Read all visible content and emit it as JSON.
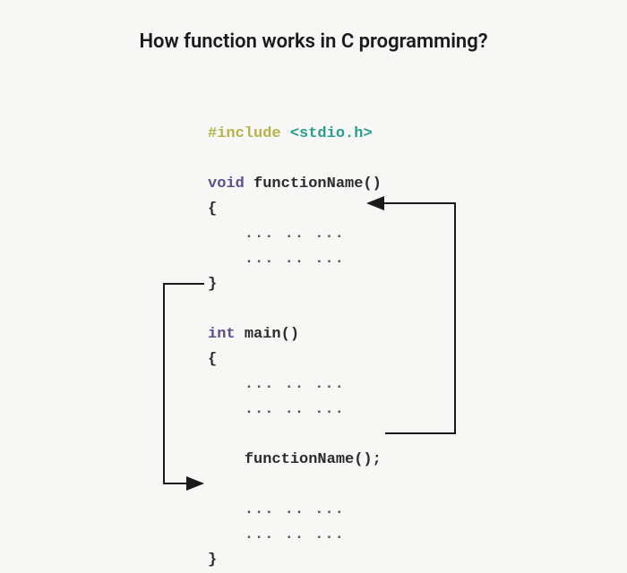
{
  "title": "How function works in C programming?",
  "code": {
    "include_kw": "#include",
    "include_lib": "<stdio.h>",
    "void_kw": "void",
    "func_decl": "functionName()",
    "open_brace": "{",
    "close_brace": "}",
    "dots_line": "... .. ...",
    "int_kw": "int",
    "main_decl": "main()",
    "func_call": "functionName();"
  }
}
